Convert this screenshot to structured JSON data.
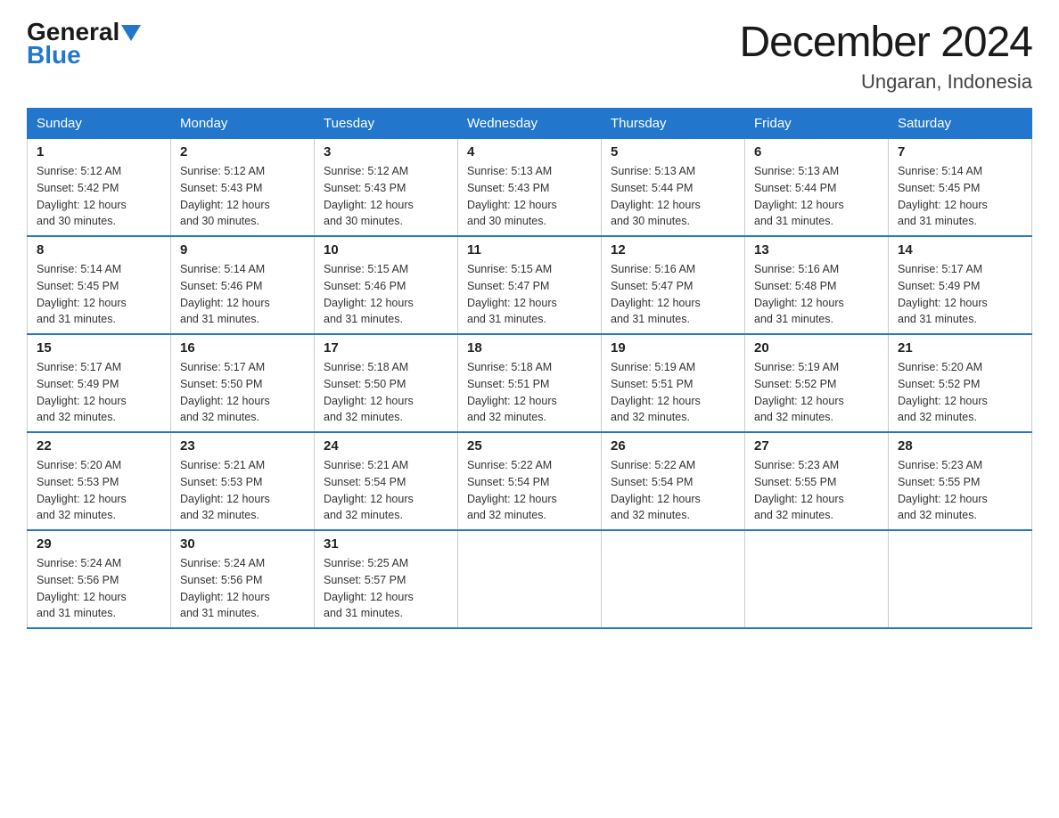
{
  "header": {
    "logo_general": "General",
    "logo_blue": "Blue",
    "month_title": "December 2024",
    "location": "Ungaran, Indonesia"
  },
  "days_of_week": [
    "Sunday",
    "Monday",
    "Tuesday",
    "Wednesday",
    "Thursday",
    "Friday",
    "Saturday"
  ],
  "weeks": [
    [
      {
        "day": "1",
        "sunrise": "5:12 AM",
        "sunset": "5:42 PM",
        "daylight": "12 hours and 30 minutes."
      },
      {
        "day": "2",
        "sunrise": "5:12 AM",
        "sunset": "5:43 PM",
        "daylight": "12 hours and 30 minutes."
      },
      {
        "day": "3",
        "sunrise": "5:12 AM",
        "sunset": "5:43 PM",
        "daylight": "12 hours and 30 minutes."
      },
      {
        "day": "4",
        "sunrise": "5:13 AM",
        "sunset": "5:43 PM",
        "daylight": "12 hours and 30 minutes."
      },
      {
        "day": "5",
        "sunrise": "5:13 AM",
        "sunset": "5:44 PM",
        "daylight": "12 hours and 30 minutes."
      },
      {
        "day": "6",
        "sunrise": "5:13 AM",
        "sunset": "5:44 PM",
        "daylight": "12 hours and 31 minutes."
      },
      {
        "day": "7",
        "sunrise": "5:14 AM",
        "sunset": "5:45 PM",
        "daylight": "12 hours and 31 minutes."
      }
    ],
    [
      {
        "day": "8",
        "sunrise": "5:14 AM",
        "sunset": "5:45 PM",
        "daylight": "12 hours and 31 minutes."
      },
      {
        "day": "9",
        "sunrise": "5:14 AM",
        "sunset": "5:46 PM",
        "daylight": "12 hours and 31 minutes."
      },
      {
        "day": "10",
        "sunrise": "5:15 AM",
        "sunset": "5:46 PM",
        "daylight": "12 hours and 31 minutes."
      },
      {
        "day": "11",
        "sunrise": "5:15 AM",
        "sunset": "5:47 PM",
        "daylight": "12 hours and 31 minutes."
      },
      {
        "day": "12",
        "sunrise": "5:16 AM",
        "sunset": "5:47 PM",
        "daylight": "12 hours and 31 minutes."
      },
      {
        "day": "13",
        "sunrise": "5:16 AM",
        "sunset": "5:48 PM",
        "daylight": "12 hours and 31 minutes."
      },
      {
        "day": "14",
        "sunrise": "5:17 AM",
        "sunset": "5:49 PM",
        "daylight": "12 hours and 31 minutes."
      }
    ],
    [
      {
        "day": "15",
        "sunrise": "5:17 AM",
        "sunset": "5:49 PM",
        "daylight": "12 hours and 32 minutes."
      },
      {
        "day": "16",
        "sunrise": "5:17 AM",
        "sunset": "5:50 PM",
        "daylight": "12 hours and 32 minutes."
      },
      {
        "day": "17",
        "sunrise": "5:18 AM",
        "sunset": "5:50 PM",
        "daylight": "12 hours and 32 minutes."
      },
      {
        "day": "18",
        "sunrise": "5:18 AM",
        "sunset": "5:51 PM",
        "daylight": "12 hours and 32 minutes."
      },
      {
        "day": "19",
        "sunrise": "5:19 AM",
        "sunset": "5:51 PM",
        "daylight": "12 hours and 32 minutes."
      },
      {
        "day": "20",
        "sunrise": "5:19 AM",
        "sunset": "5:52 PM",
        "daylight": "12 hours and 32 minutes."
      },
      {
        "day": "21",
        "sunrise": "5:20 AM",
        "sunset": "5:52 PM",
        "daylight": "12 hours and 32 minutes."
      }
    ],
    [
      {
        "day": "22",
        "sunrise": "5:20 AM",
        "sunset": "5:53 PM",
        "daylight": "12 hours and 32 minutes."
      },
      {
        "day": "23",
        "sunrise": "5:21 AM",
        "sunset": "5:53 PM",
        "daylight": "12 hours and 32 minutes."
      },
      {
        "day": "24",
        "sunrise": "5:21 AM",
        "sunset": "5:54 PM",
        "daylight": "12 hours and 32 minutes."
      },
      {
        "day": "25",
        "sunrise": "5:22 AM",
        "sunset": "5:54 PM",
        "daylight": "12 hours and 32 minutes."
      },
      {
        "day": "26",
        "sunrise": "5:22 AM",
        "sunset": "5:54 PM",
        "daylight": "12 hours and 32 minutes."
      },
      {
        "day": "27",
        "sunrise": "5:23 AM",
        "sunset": "5:55 PM",
        "daylight": "12 hours and 32 minutes."
      },
      {
        "day": "28",
        "sunrise": "5:23 AM",
        "sunset": "5:55 PM",
        "daylight": "12 hours and 32 minutes."
      }
    ],
    [
      {
        "day": "29",
        "sunrise": "5:24 AM",
        "sunset": "5:56 PM",
        "daylight": "12 hours and 31 minutes."
      },
      {
        "day": "30",
        "sunrise": "5:24 AM",
        "sunset": "5:56 PM",
        "daylight": "12 hours and 31 minutes."
      },
      {
        "day": "31",
        "sunrise": "5:25 AM",
        "sunset": "5:57 PM",
        "daylight": "12 hours and 31 minutes."
      },
      null,
      null,
      null,
      null
    ]
  ],
  "labels": {
    "sunrise": "Sunrise:",
    "sunset": "Sunset:",
    "daylight": "Daylight:"
  }
}
